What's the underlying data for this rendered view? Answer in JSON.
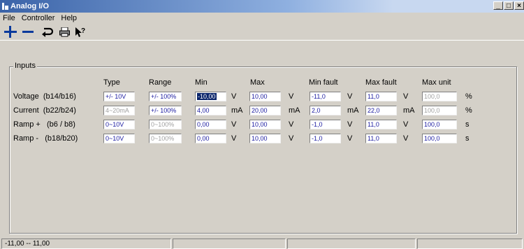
{
  "window": {
    "title": "Analog I/O",
    "buttons": [
      "_",
      "□",
      "×"
    ]
  },
  "menu": [
    "File",
    "Controller",
    "Help"
  ],
  "toolbar": {
    "icons": [
      "plus-icon",
      "minus-icon",
      "undo-icon",
      "print-icon",
      "help-pointer-icon"
    ]
  },
  "inputs": {
    "group_title": "Inputs",
    "headers": {
      "type": "Type",
      "range": "Range",
      "min": "Min",
      "max": "Max",
      "min_fault": "Min fault",
      "max_fault": "Max fault",
      "max_unit": "Max unit"
    },
    "rows": [
      {
        "label": "Voltage  (b14/b16)",
        "type": "+/- 10V",
        "range": "+/- 100%",
        "min": "-10,00",
        "min_unit": "V",
        "max": "10,00",
        "max_unit_l": "V",
        "min_fault": "-11,0",
        "mf_unit": "V",
        "max_fault": "11,0",
        "xf_unit": "V",
        "max_unit": "100,0",
        "unit": "%"
      },
      {
        "label": "Current  (b22/b24)",
        "type": "4~20mA",
        "range": "+/- 100%",
        "min": "4,00",
        "min_unit": "mA",
        "max": "20,00",
        "max_unit_l": "mA",
        "min_fault": "2,0",
        "mf_unit": "mA",
        "max_fault": "22,0",
        "xf_unit": "mA",
        "max_unit": "100,0",
        "unit": "%"
      },
      {
        "label": "Ramp +   (b6 / b8)",
        "type": "0~10V",
        "range": "0~100%",
        "min": "0,00",
        "min_unit": "V",
        "max": "10,00",
        "max_unit_l": "V",
        "min_fault": "-1,0",
        "mf_unit": "V",
        "max_fault": "11,0",
        "xf_unit": "V",
        "max_unit": "100,0",
        "unit": "s"
      },
      {
        "label": "Ramp -   (b18/b20)",
        "type": "0~10V",
        "range": "0~100%",
        "min": "0,00",
        "min_unit": "V",
        "max": "10,00",
        "max_unit_l": "V",
        "min_fault": "-1,0",
        "mf_unit": "V",
        "max_fault": "11,0",
        "xf_unit": "V",
        "max_unit": "100,0",
        "unit": "s"
      }
    ]
  },
  "status": {
    "range": "-11,00 -- 11,00"
  }
}
